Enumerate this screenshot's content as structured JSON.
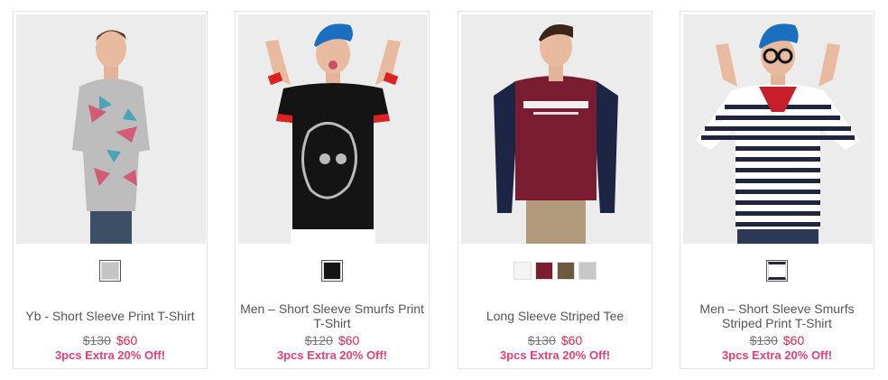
{
  "products": [
    {
      "title": "Yb - Short Sleeve Print T-Shirt",
      "old_price": "$130",
      "new_price": "$60",
      "promo": "3pcs Extra 20% Off!",
      "swatches": [
        "#c4c4c4"
      ]
    },
    {
      "title": "Men – Short Sleeve Smurfs Print T-Shirt",
      "old_price": "$120",
      "new_price": "$60",
      "promo": "3pcs Extra 20% Off!",
      "swatches": [
        "#151515"
      ]
    },
    {
      "title": "Long Sleeve Striped Tee",
      "old_price": "$130",
      "new_price": "$60",
      "promo": "3pcs Extra 20% Off!",
      "swatches": [
        "#f4f4f4",
        "#7a1d33",
        "#6b5a3f",
        "#c8c8c8"
      ]
    },
    {
      "title": "Men – Short Sleeve Smurfs Striped Print T-Shirt",
      "old_price": "$130",
      "new_price": "$60",
      "promo": "3pcs Extra 20% Off!",
      "swatches": [
        "#ffffff"
      ]
    }
  ],
  "colors": {
    "sale_price": "#e0234f",
    "promo": "#e93e76"
  }
}
